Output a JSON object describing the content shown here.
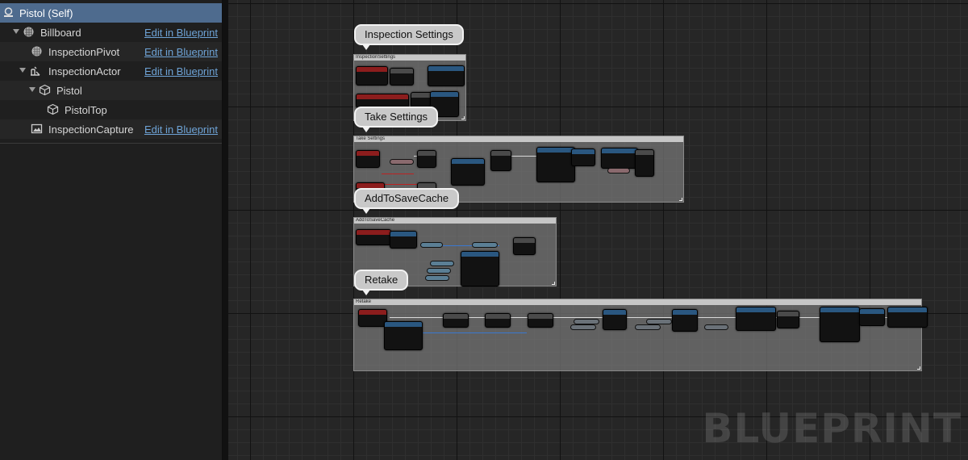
{
  "components": {
    "items": [
      {
        "label": "Pistol (Self)",
        "icon": "self-icon",
        "edit": ""
      },
      {
        "label": "Billboard",
        "icon": "billboard-icon",
        "edit": "Edit in Blueprint"
      },
      {
        "label": "InspectionPivot",
        "icon": "sphere-icon",
        "edit": "Edit in Blueprint"
      },
      {
        "label": "InspectionActor",
        "icon": "child-actor-icon",
        "edit": "Edit in Blueprint"
      },
      {
        "label": "Pistol",
        "icon": "static-mesh-icon",
        "edit": ""
      },
      {
        "label": "PistolTop",
        "icon": "static-mesh-icon",
        "edit": ""
      },
      {
        "label": "InspectionCapture",
        "icon": "scene-capture-icon",
        "edit": "Edit in Blueprint"
      }
    ]
  },
  "graph": {
    "comments": [
      {
        "bubble": "Inspection Settings",
        "header": "InspectionSettings"
      },
      {
        "bubble": "Take Settings",
        "header": "Take Settings"
      },
      {
        "bubble": "AddToSaveCache",
        "header": "AddToSaveCache"
      },
      {
        "bubble": "Retake",
        "header": "Retake"
      }
    ],
    "watermark": "BLUEPRINT"
  },
  "colors": {
    "selection": "#4e6b8e",
    "link": "#6ea3d6",
    "event_header": "#8c1d1d",
    "function_header": "#2a5780",
    "exec_wire": "#d8d8d8",
    "data_wire": "#3a78d0"
  }
}
